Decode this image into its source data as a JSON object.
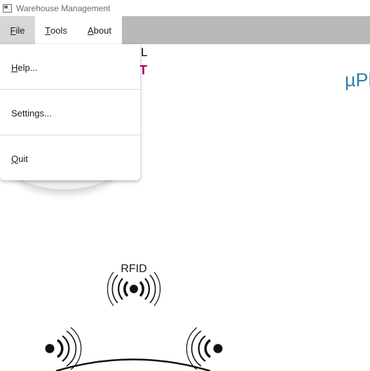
{
  "window": {
    "title": "Warehouse Management",
    "icon": "app-window-icon"
  },
  "menubar": {
    "file_mnemonic": "F",
    "file_rest": "ile",
    "tools_mnemonic": "T",
    "tools_rest": "ools",
    "about_mnemonic": "A",
    "about_rest": "bout"
  },
  "file_menu": {
    "help_mnemonic": "H",
    "help_rest": "elp...",
    "settings_label": "Settings...",
    "quit_mnemonic": "Q",
    "quit_rest": "uit"
  },
  "background": {
    "letter_l": "L",
    "letter_t": "T",
    "brand_text": "µPl",
    "rfid_label": "RFID",
    "icons": [
      "rfid-tag-icon",
      "signal-left-icon",
      "signal-right-icon",
      "reader-arc-icon"
    ]
  },
  "colors": {
    "menubar_bg": "#b9b9b9",
    "file_active_bg": "#d6d6d6",
    "brand_blue": "#2e7fb0",
    "accent_magenta": "#b0006a"
  }
}
